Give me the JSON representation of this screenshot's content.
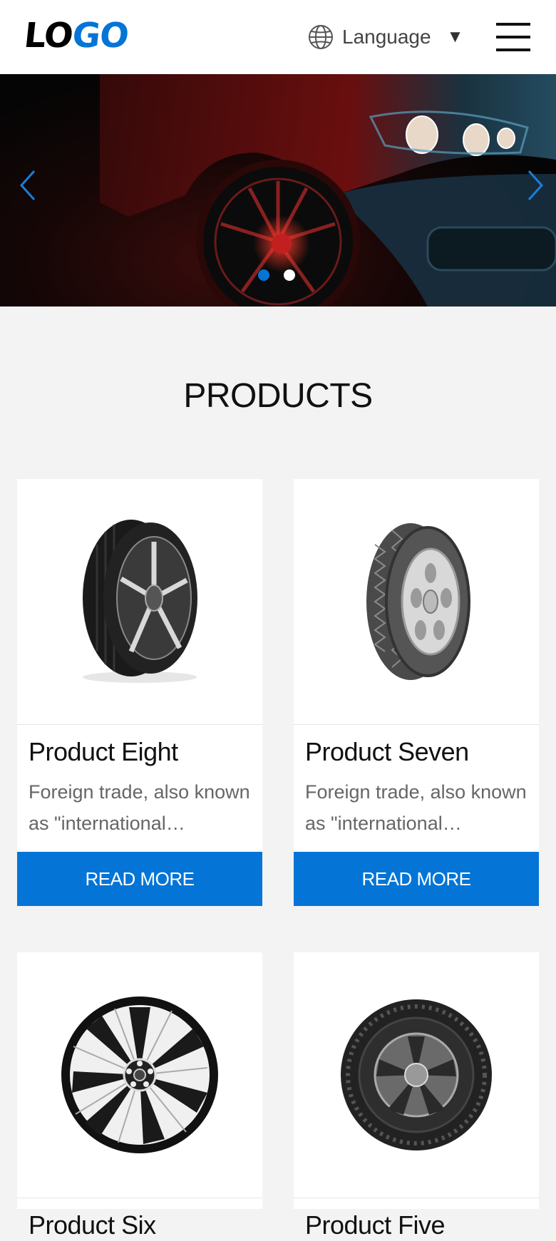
{
  "header": {
    "logo": {
      "part1": "LO",
      "part2": "GO"
    },
    "language_label": "Language",
    "language_caret": "▼",
    "icons": {
      "language": "globe-icon",
      "menu": "hamburger-menu-icon"
    }
  },
  "hero": {
    "slide_count": 2,
    "active_slide": 1,
    "icons": {
      "prev": "chevron-left-icon",
      "next": "chevron-right-icon"
    }
  },
  "products": {
    "title": "PRODUCTS",
    "items": [
      {
        "title": "Product Eight",
        "description": "Foreign trade, also known as \"international…",
        "button": "READ MORE",
        "image": "performance-tire"
      },
      {
        "title": "Product Seven",
        "description": "Foreign trade, also known as \"international…",
        "button": "READ MORE",
        "image": "van-tire"
      },
      {
        "title": "Product Six",
        "description": "",
        "button": "",
        "image": "alloy-rim"
      },
      {
        "title": "Product Five",
        "description": "",
        "button": "",
        "image": "tire-with-rim"
      }
    ]
  },
  "colors": {
    "accent": "#0475d6",
    "dot_active": "#0475d6",
    "dot_inactive": "#ffffff",
    "page_bg": "#f3f3f3"
  }
}
